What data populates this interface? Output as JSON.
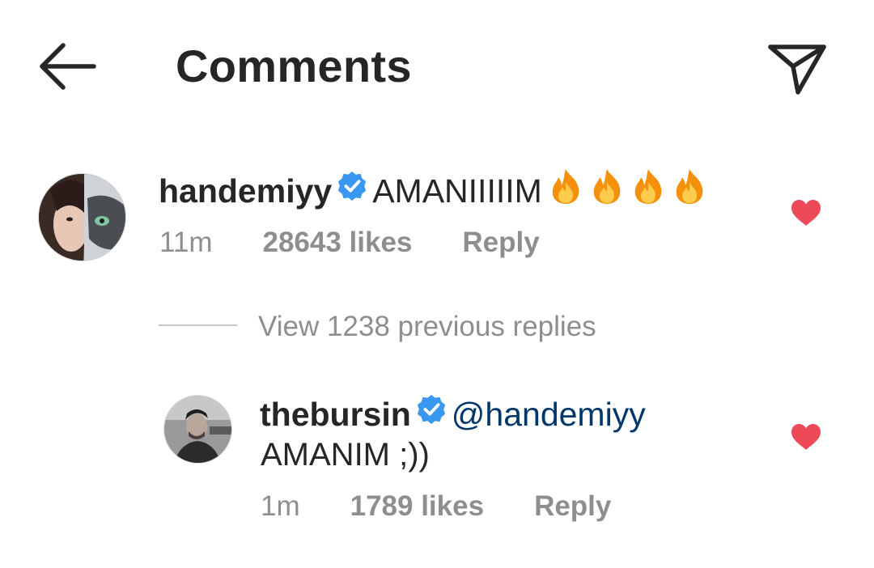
{
  "header": {
    "title": "Comments",
    "back_icon": "arrow-left-icon",
    "share_icon": "paper-plane-icon"
  },
  "comments": [
    {
      "username": "handemiyy",
      "verified": true,
      "text": "AMANIIIIIM",
      "emoji": [
        "fire-icon",
        "fire-icon",
        "fire-icon",
        "fire-icon"
      ],
      "time": "11m",
      "likes": "28643 likes",
      "reply_label": "Reply",
      "liked": true
    }
  ],
  "view_replies": "View 1238 previous replies",
  "replies": [
    {
      "username": "thebursin",
      "verified": true,
      "mention": "@handemiyy",
      "text": "AMANIM ;))",
      "time": "1m",
      "likes": "1789 likes",
      "reply_label": "Reply",
      "liked": true
    }
  ],
  "colors": {
    "text": "#262626",
    "secondary": "#8e8e8e",
    "mention": "#00376b",
    "verified": "#3897f0",
    "heart": "#ed4956"
  }
}
